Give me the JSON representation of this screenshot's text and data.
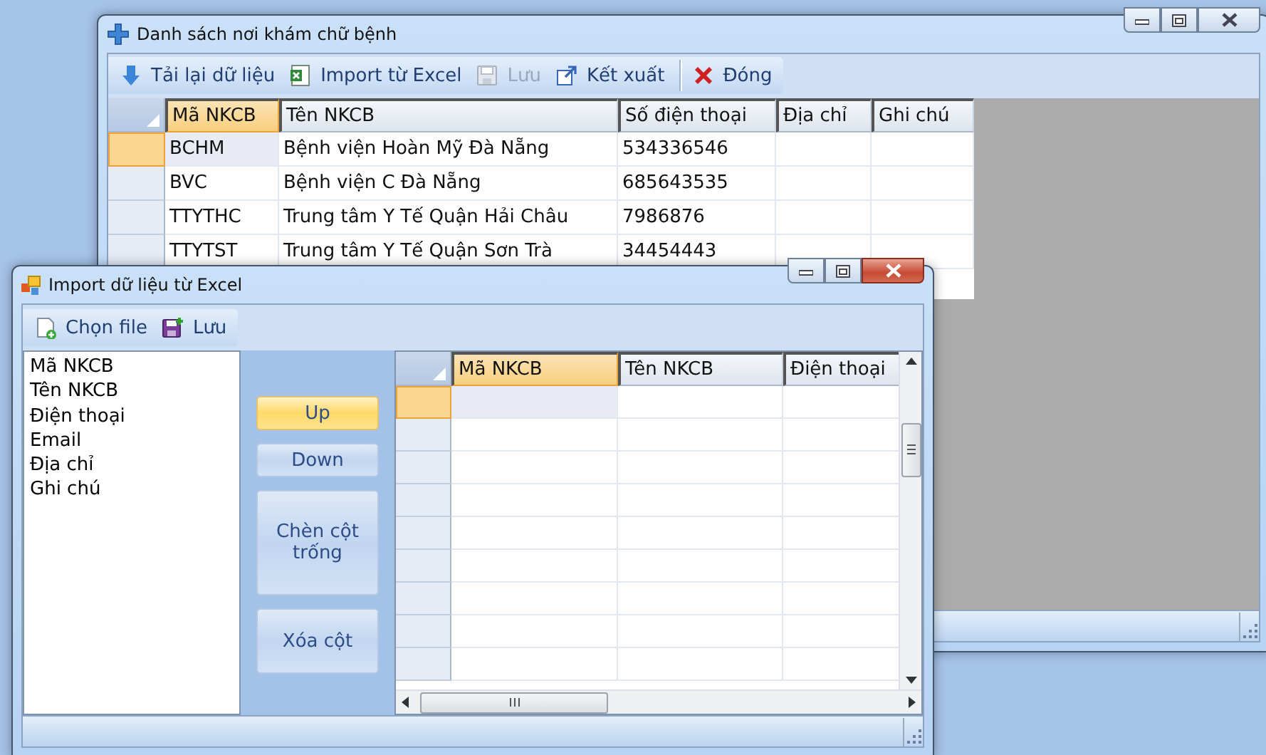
{
  "main_window": {
    "title": "Danh sách nơi khám chữ bệnh",
    "toolbar": [
      {
        "kind": "reload",
        "label": "Tải lại dữ liệu",
        "disabled": false,
        "separator_before": false
      },
      {
        "kind": "excel",
        "label": "Import từ Excel",
        "disabled": false,
        "separator_before": false
      },
      {
        "kind": "save",
        "label": "Lưu",
        "disabled": true,
        "separator_before": false
      },
      {
        "kind": "export",
        "label": "Kết xuất",
        "disabled": false,
        "separator_before": false
      },
      {
        "kind": "close",
        "label": "Đóng",
        "disabled": false,
        "separator_before": true
      }
    ],
    "table": {
      "columns": [
        {
          "label": "Mã NKCB",
          "selected": true
        },
        {
          "label": "Tên NKCB",
          "selected": false
        },
        {
          "label": "Số điện thoại",
          "selected": false
        },
        {
          "label": "Địa chỉ",
          "selected": false
        },
        {
          "label": "Ghi chú",
          "selected": false
        }
      ],
      "rows": [
        {
          "selected": true,
          "cells": [
            "BCHM",
            "Bệnh viện Hoàn Mỹ Đà Nẵng",
            "534336546"
          ]
        },
        {
          "selected": false,
          "cells": [
            "BVC",
            "Bệnh viện C Đà Nẵng",
            "685643535"
          ]
        },
        {
          "selected": false,
          "cells": [
            "TTYTHC",
            "Trung tâm Y Tế Quận Hải Châu",
            "7986876"
          ]
        },
        {
          "selected": false,
          "cells": [
            "TTYTST",
            "Trung tâm Y Tế Quận Sơn Trà",
            "34454443"
          ]
        }
      ]
    }
  },
  "import_dialog": {
    "title": "Import dữ liệu từ Excel",
    "toolbar": [
      {
        "kind": "open-file",
        "label": "Chọn file",
        "disabled": false,
        "separator_before": false
      },
      {
        "kind": "save-file",
        "label": "Lưu",
        "disabled": false,
        "separator_before": false
      }
    ],
    "field_list": [
      "Mã NKCB",
      "Tên NKCB",
      "Điện thoại",
      "Email",
      "Địa chỉ",
      "Ghi chú"
    ],
    "side_buttons": [
      {
        "label": "Up",
        "highlighted": true
      },
      {
        "label": "Down",
        "highlighted": false
      },
      {
        "label": "Chèn cột trống",
        "highlighted": false
      },
      {
        "label": "Xóa cột",
        "highlighted": false
      }
    ],
    "table": {
      "columns": [
        {
          "label": "Mã NKCB",
          "selected": true
        },
        {
          "label": "Tên NKCB",
          "selected": false
        },
        {
          "label": "Điện thoại",
          "selected": false
        }
      ],
      "rows": [
        {
          "selected": true,
          "cells": []
        },
        {
          "selected": false,
          "cells": []
        },
        {
          "selected": false,
          "cells": []
        },
        {
          "selected": false,
          "cells": []
        },
        {
          "selected": false,
          "cells": []
        },
        {
          "selected": false,
          "cells": []
        },
        {
          "selected": false,
          "cells": []
        },
        {
          "selected": false,
          "cells": []
        },
        {
          "selected": false,
          "cells": []
        }
      ]
    }
  }
}
